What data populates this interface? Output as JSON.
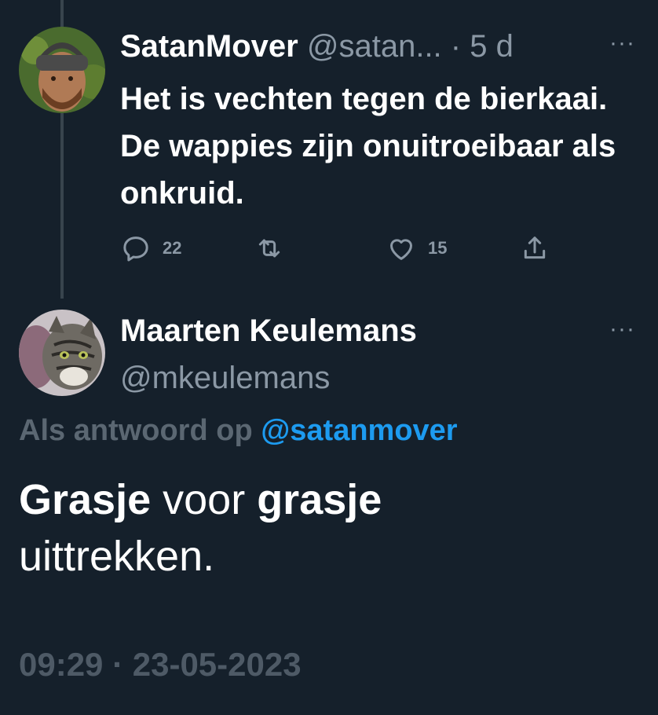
{
  "parent_tweet": {
    "display_name": "SatanMover",
    "handle_time": "@satan... · 5 d",
    "text": "Het is vechten tegen de bierkaai. De wappies zijn onuitroeibaar als onkruid.",
    "more_label": "···",
    "reply_count": "22",
    "retweet_count": "",
    "like_count": "15"
  },
  "main_tweet": {
    "display_name": "Maarten Keulemans",
    "handle": "@mkeulemans",
    "more_label": "···",
    "reply_context_prefix": "Als antwoord op",
    "reply_context_mention": "@satanmover",
    "text_parts": {
      "w1": "Grasje",
      "w2": " voor ",
      "w3": "grasje",
      "w4": "uittrekken."
    },
    "timestamp": "09:29 · 23-05-2023"
  },
  "colors": {
    "background": "#15202b",
    "secondary_text": "#8b98a5",
    "link": "#1d9bf0"
  }
}
